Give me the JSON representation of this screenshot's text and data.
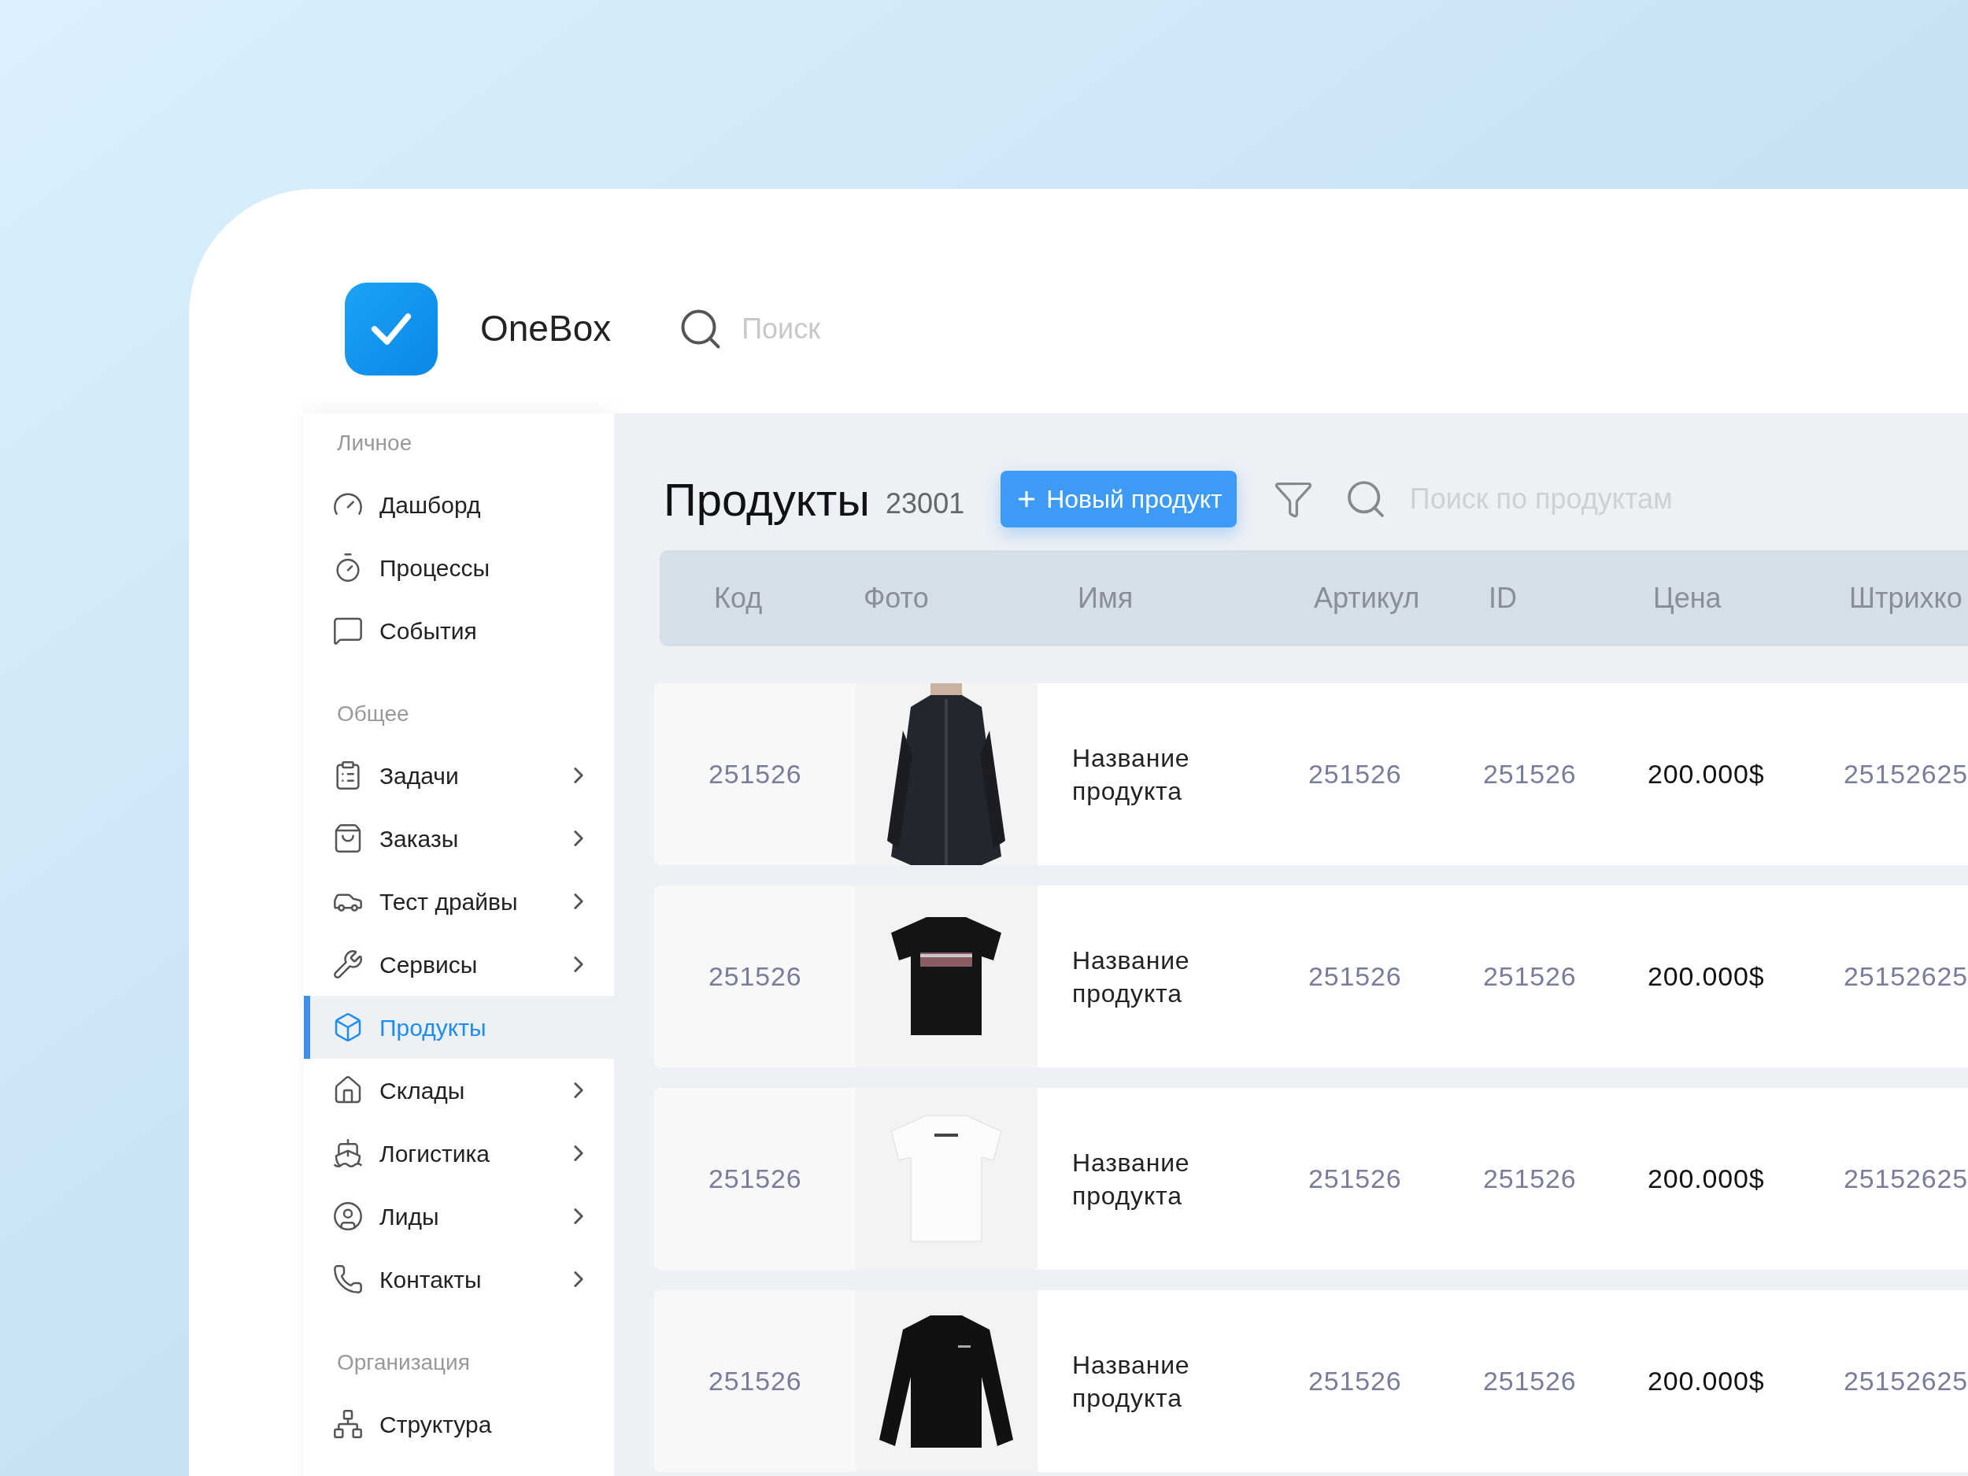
{
  "app": {
    "name": "OneBox",
    "search_placeholder": "Поиск"
  },
  "sidebar": [
    {
      "title": "Личное",
      "items": [
        {
          "label": "Дашборд",
          "kind": "gauge",
          "has_submenu": false,
          "selected": false
        },
        {
          "label": "Процессы",
          "kind": "timer",
          "has_submenu": false,
          "selected": false
        },
        {
          "label": "События",
          "kind": "chat",
          "has_submenu": false,
          "selected": false
        }
      ]
    },
    {
      "title": "Общее",
      "items": [
        {
          "label": "Задачи",
          "kind": "clipboard",
          "has_submenu": true,
          "selected": false
        },
        {
          "label": "Заказы",
          "kind": "bag",
          "has_submenu": true,
          "selected": false
        },
        {
          "label": "Тест драйвы",
          "kind": "car",
          "has_submenu": true,
          "selected": false
        },
        {
          "label": "Сервисы",
          "kind": "wrench",
          "has_submenu": true,
          "selected": false
        },
        {
          "label": "Продукты",
          "kind": "box",
          "has_submenu": false,
          "selected": true
        },
        {
          "label": "Склады",
          "kind": "house",
          "has_submenu": true,
          "selected": false
        },
        {
          "label": "Логистика",
          "kind": "ship",
          "has_submenu": true,
          "selected": false
        },
        {
          "label": "Лиды",
          "kind": "user",
          "has_submenu": true,
          "selected": false
        },
        {
          "label": "Контакты",
          "kind": "phone",
          "has_submenu": true,
          "selected": false
        }
      ]
    },
    {
      "title": "Организация",
      "items": [
        {
          "label": "Структура",
          "kind": "network",
          "has_submenu": false,
          "selected": false
        }
      ]
    }
  ],
  "page": {
    "title": "Продукты",
    "count": "23001",
    "new_button": "Новый продукт",
    "search_placeholder": "Поиск по продуктам"
  },
  "table": {
    "columns": [
      "Код",
      "Фото",
      "Имя",
      "Артикул",
      "ID",
      "Цена",
      "Штрихко"
    ],
    "rows": [
      {
        "code": "251526",
        "name": "Название продукта",
        "article": "251526",
        "id": "251526",
        "price": "200.000$",
        "barcode": "25152625"
      },
      {
        "code": "251526",
        "name": "Название продукта",
        "article": "251526",
        "id": "251526",
        "price": "200.000$",
        "barcode": "25152625"
      },
      {
        "code": "251526",
        "name": "Название продукта",
        "article": "251526",
        "id": "251526",
        "price": "200.000$",
        "barcode": "25152625"
      },
      {
        "code": "251526",
        "name": "Название продукта",
        "article": "251526",
        "id": "251526",
        "price": "200.000$",
        "barcode": "25152625"
      }
    ]
  }
}
